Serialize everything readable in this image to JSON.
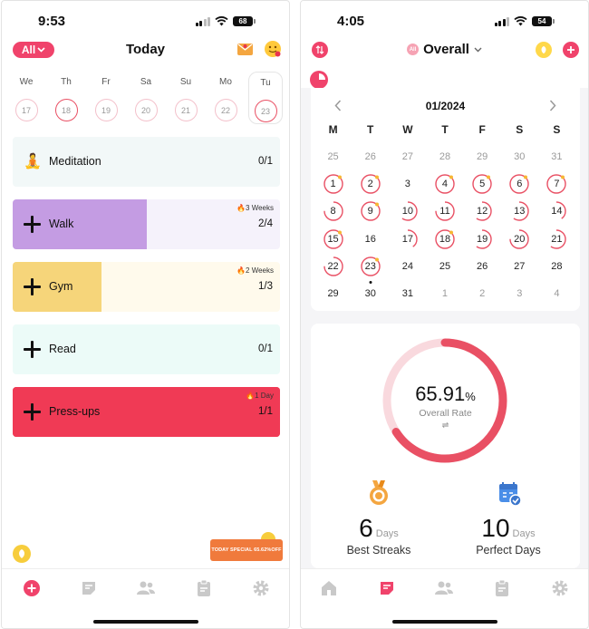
{
  "left": {
    "status": {
      "time": "9:53",
      "battery": "68"
    },
    "filter_label": "All",
    "title": "Today",
    "week": [
      {
        "name": "We",
        "date": "17"
      },
      {
        "name": "Th",
        "date": "18"
      },
      {
        "name": "Fr",
        "date": "19"
      },
      {
        "name": "Sa",
        "date": "20"
      },
      {
        "name": "Su",
        "date": "21"
      },
      {
        "name": "Mo",
        "date": "22"
      },
      {
        "name": "Tu",
        "date": "23"
      }
    ],
    "habits": [
      {
        "name": "Meditation",
        "count": "0/1",
        "streak": "",
        "progress": 0,
        "color": "#f2f8f8",
        "fill": "#f2f8f8",
        "text": "#111",
        "icon": "meditation"
      },
      {
        "name": "Walk",
        "count": "2/4",
        "streak": "🔥3 Weeks",
        "progress": 0.5,
        "color": "#f5f2fb",
        "fill": "#c49ce3",
        "text": "#111",
        "icon": "plus"
      },
      {
        "name": "Gym",
        "count": "1/3",
        "streak": "🔥2 Weeks",
        "progress": 0.333,
        "color": "#fffaec",
        "fill": "#f6d57a",
        "text": "#111",
        "icon": "plus"
      },
      {
        "name": "Read",
        "count": "0/1",
        "streak": "",
        "progress": 0,
        "color": "#ecfbf8",
        "fill": "#ecfbf8",
        "text": "#111",
        "icon": "plus"
      },
      {
        "name": "Press-ups",
        "count": "1/1",
        "streak": "🔥1 Day",
        "progress": 1,
        "color": "#f03a55",
        "fill": "#f03a55",
        "text": "#111",
        "icon": "plus"
      }
    ],
    "promo": "TODAY SPECIAL 65.62%OFF"
  },
  "right": {
    "status": {
      "time": "4:05",
      "battery": "54"
    },
    "title": "Overall",
    "month": "01/2024",
    "weekdays": [
      "M",
      "T",
      "W",
      "T",
      "F",
      "S",
      "S"
    ],
    "days": [
      {
        "d": "25",
        "m": true
      },
      {
        "d": "26",
        "m": true
      },
      {
        "d": "27",
        "m": true
      },
      {
        "d": "28",
        "m": true
      },
      {
        "d": "29",
        "m": true
      },
      {
        "d": "30",
        "m": true
      },
      {
        "d": "31",
        "m": true
      },
      {
        "d": "1",
        "p": 1,
        "star": true
      },
      {
        "d": "2",
        "p": 1,
        "star": true
      },
      {
        "d": "3",
        "p": 0
      },
      {
        "d": "4",
        "p": 1,
        "star": true
      },
      {
        "d": "5",
        "p": 1,
        "star": true
      },
      {
        "d": "6",
        "p": 1,
        "star": true
      },
      {
        "d": "7",
        "p": 1,
        "star": true
      },
      {
        "d": "8",
        "p": 0.75
      },
      {
        "d": "9",
        "p": 1,
        "star": true
      },
      {
        "d": "10",
        "p": 0.6
      },
      {
        "d": "11",
        "p": 0.75
      },
      {
        "d": "12",
        "p": 0.6
      },
      {
        "d": "13",
        "p": 0.6
      },
      {
        "d": "14",
        "p": 0.4
      },
      {
        "d": "15",
        "p": 1,
        "star": true
      },
      {
        "d": "16",
        "p": 0
      },
      {
        "d": "17",
        "p": 0.4
      },
      {
        "d": "18",
        "p": 1,
        "star": true
      },
      {
        "d": "19",
        "p": 0.6
      },
      {
        "d": "20",
        "p": 0.75
      },
      {
        "d": "21",
        "p": 0.6
      },
      {
        "d": "22",
        "p": 0.75
      },
      {
        "d": "23",
        "p": 1,
        "star": true,
        "today": true
      },
      {
        "d": "24",
        "p": 0
      },
      {
        "d": "25",
        "p": 0
      },
      {
        "d": "26",
        "p": 0
      },
      {
        "d": "27",
        "p": 0
      },
      {
        "d": "28",
        "p": 0
      },
      {
        "d": "29",
        "p": 0
      },
      {
        "d": "30",
        "p": 0
      },
      {
        "d": "31",
        "p": 0
      },
      {
        "d": "1",
        "m": true
      },
      {
        "d": "2",
        "m": true
      },
      {
        "d": "3",
        "m": true
      },
      {
        "d": "4",
        "m": true
      }
    ],
    "rate": {
      "value": "65.91",
      "unit": "%",
      "label": "Overall Rate",
      "fraction": 0.6591
    },
    "streaks": {
      "value": "6",
      "unit": "Days",
      "label": "Best Streaks"
    },
    "perfect": {
      "value": "10",
      "unit": "Days",
      "label": "Perfect Days"
    }
  },
  "colors": {
    "accent": "#f0436b",
    "ring": "#e95064",
    "ring_faint": "#f9d9de"
  }
}
